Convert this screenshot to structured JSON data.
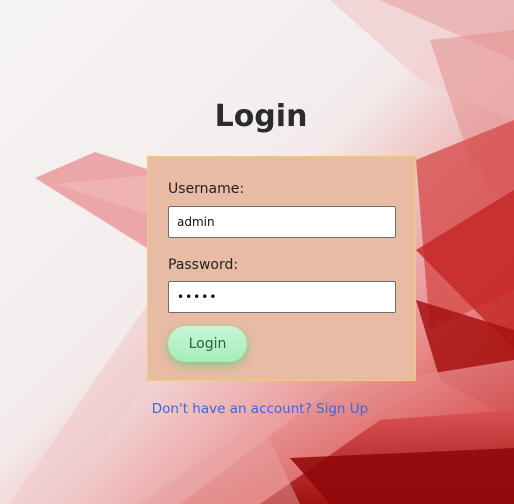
{
  "page": {
    "title": "Login"
  },
  "form": {
    "username_label": "Username:",
    "username_value": "admin",
    "password_label": "Password:",
    "password_value": "admin",
    "submit_label": "Login"
  },
  "footer": {
    "signup_text": "Don't have an account? Sign Up"
  },
  "colors": {
    "card_background": "#e8bca4",
    "card_border": "#f3c983",
    "button_background": "#b3f1c4",
    "link": "#3a66e0",
    "background_accent": "#c71818"
  }
}
